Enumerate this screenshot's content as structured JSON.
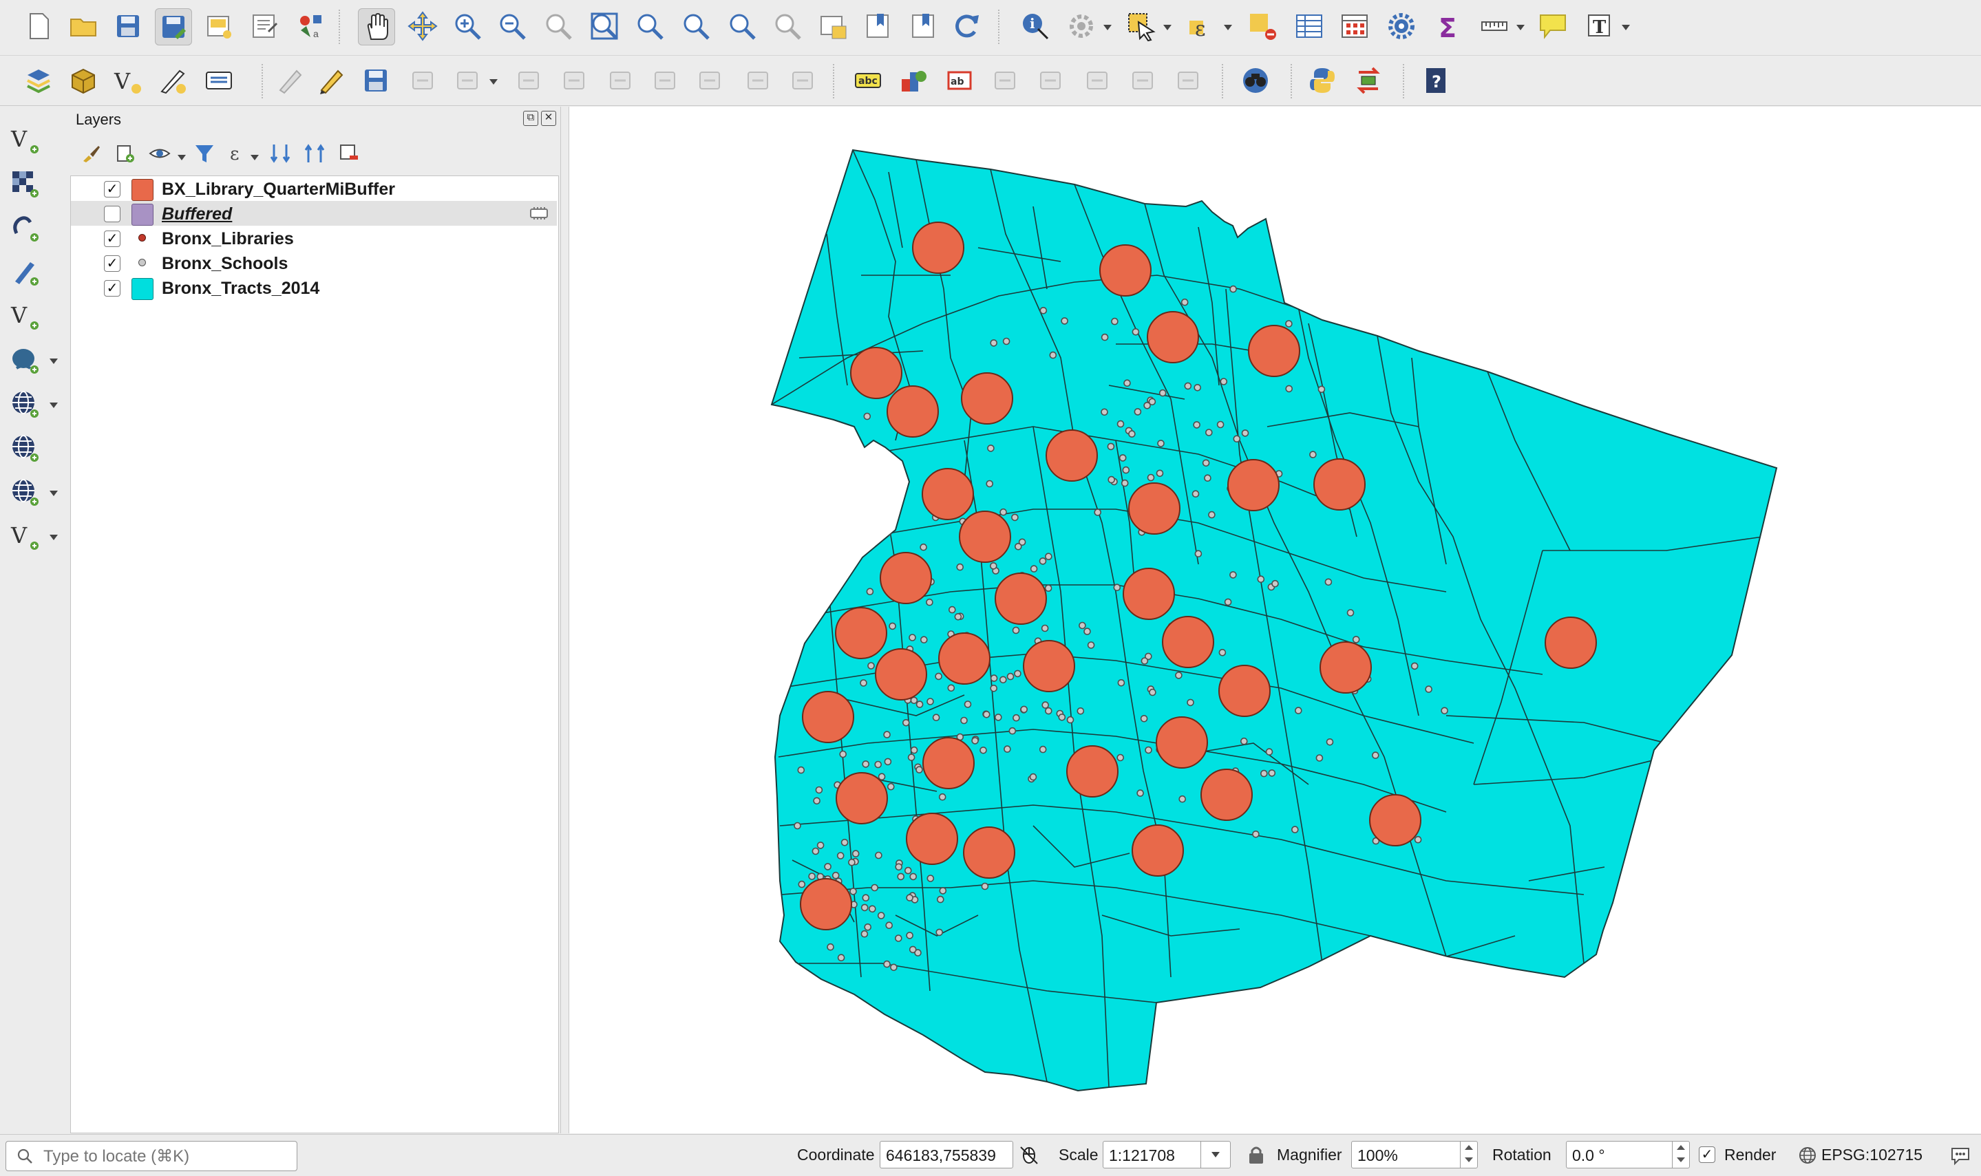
{
  "app": "QGIS",
  "toolbar_top": {
    "icons": [
      "new-project-icon",
      "open-project-icon",
      "save-project-icon",
      "save-as-icon",
      "print-layout-icon",
      "layout-manager-icon",
      "style-manager-icon",
      "pan-icon",
      "pan-to-selection-icon",
      "zoom-in-icon",
      "zoom-out-icon",
      "zoom-native-icon",
      "zoom-full-icon",
      "zoom-to-selection-icon",
      "zoom-to-layer-icon",
      "zoom-last-icon",
      "zoom-next-icon",
      "new-map-view-icon",
      "new-bookmark-icon",
      "show-bookmarks-icon",
      "refresh-icon",
      "identify-icon",
      "action-icon",
      "select-icon",
      "select-by-expression-icon",
      "deselect-icon",
      "attribute-table-icon",
      "field-calculator-icon",
      "toolbox-icon",
      "statistics-icon",
      "measure-icon",
      "annotation-icon",
      "text-annotation-icon"
    ]
  },
  "toolbar_second": {
    "icons": [
      "data-source-manager-icon",
      "new-geopackage-icon",
      "new-shapefile-icon",
      "new-temp-layer-icon",
      "new-virtual-layer-icon",
      "current-edits-icon",
      "toggle-editing-icon",
      "save-edits-icon",
      "digitize-icon",
      "vertex-tool-icon",
      "modify-attributes-icon",
      "delete-selected-icon",
      "cut-features-icon",
      "copy-features-icon",
      "paste-features-icon",
      "undo-icon",
      "redo-icon",
      "label-toolbar-icon",
      "diagram-icon",
      "highlight-label-icon",
      "pin-label-icon",
      "show-hide-label-icon",
      "move-label-icon",
      "rotate-label-icon",
      "change-label-icon",
      "plugin-binoculars-icon",
      "python-console-icon",
      "plugin-reload-icon",
      "help-icon"
    ]
  },
  "left_toolbar": {
    "icons": [
      "add-vector-layer-icon",
      "add-raster-layer-icon",
      "add-mesh-layer-icon",
      "add-delimited-text-icon",
      "add-spatialite-icon",
      "add-postgis-icon",
      "add-wms-icon",
      "add-xyz-icon",
      "add-wfs-icon",
      "add-virtual-layer-icon"
    ]
  },
  "layers_panel": {
    "title": "Layers",
    "layers": [
      {
        "name": "BX_Library_QuarterMiBuffer",
        "checked": true,
        "symbol": "fill",
        "color": "#e8694a",
        "selected": false
      },
      {
        "name": "Buffered",
        "checked": false,
        "symbol": "fill",
        "color": "#a892c4",
        "selected": true,
        "italic": true
      },
      {
        "name": "Bronx_Libraries",
        "checked": true,
        "symbol": "point",
        "color": "#c2392b",
        "selected": false
      },
      {
        "name": "Bronx_Schools",
        "checked": true,
        "symbol": "point",
        "color": "#8a8a8a",
        "selected": false
      },
      {
        "name": "Bronx_Tracts_2014",
        "checked": true,
        "symbol": "fill",
        "color": "#00dede",
        "selected": false
      }
    ]
  },
  "map": {
    "tract_fill": "#00e1e1",
    "buffer_fill": "#e8694a",
    "school_fill": "#c9c9c9"
  },
  "status_bar": {
    "locator_placeholder": "Type to locate (⌘K)",
    "coordinate_label": "Coordinate",
    "coordinate_value": "646183,755839",
    "scale_label": "Scale",
    "scale_value": "1:121708",
    "magnifier_label": "Magnifier",
    "magnifier_value": "100%",
    "rotation_label": "Rotation",
    "rotation_value": "0.0 °",
    "render_label": "Render",
    "render_checked": true,
    "crs_label": "EPSG:102715"
  }
}
